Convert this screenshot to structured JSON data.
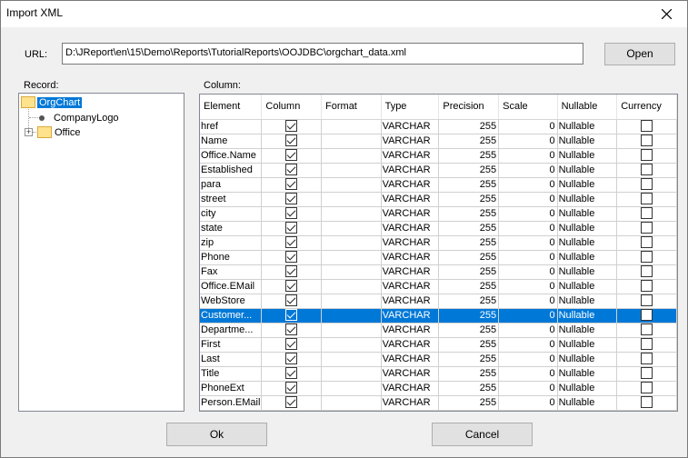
{
  "window": {
    "title": "Import XML"
  },
  "url": {
    "label": "URL:",
    "value": "D:\\JReport\\en\\15\\Demo\\Reports\\TutorialReports\\OOJDBC\\orgchart_data.xml"
  },
  "buttons": {
    "open": "Open",
    "ok": "Ok",
    "cancel": "Cancel"
  },
  "record": {
    "label": "Record:",
    "tree": [
      {
        "label": "OrgChart",
        "selected": true
      },
      {
        "label": "CompanyLogo"
      },
      {
        "label": "Office"
      }
    ]
  },
  "column": {
    "label": "Column:",
    "headers": [
      "Element",
      "Column",
      "Format",
      "Type",
      "Precision",
      "Scale",
      "Nullable",
      "Currency"
    ],
    "rows": [
      {
        "element": "href",
        "column": true,
        "format": "",
        "type": "VARCHAR",
        "precision": "255",
        "scale": "0",
        "nullable": "Nullable",
        "currency": false
      },
      {
        "element": "Name",
        "column": true,
        "format": "",
        "type": "VARCHAR",
        "precision": "255",
        "scale": "0",
        "nullable": "Nullable",
        "currency": false
      },
      {
        "element": "Office.Name",
        "column": true,
        "format": "",
        "type": "VARCHAR",
        "precision": "255",
        "scale": "0",
        "nullable": "Nullable",
        "currency": false
      },
      {
        "element": "Established",
        "column": true,
        "format": "",
        "type": "VARCHAR",
        "precision": "255",
        "scale": "0",
        "nullable": "Nullable",
        "currency": false
      },
      {
        "element": "para",
        "column": true,
        "format": "",
        "type": "VARCHAR",
        "precision": "255",
        "scale": "0",
        "nullable": "Nullable",
        "currency": false
      },
      {
        "element": "street",
        "column": true,
        "format": "",
        "type": "VARCHAR",
        "precision": "255",
        "scale": "0",
        "nullable": "Nullable",
        "currency": false
      },
      {
        "element": "city",
        "column": true,
        "format": "",
        "type": "VARCHAR",
        "precision": "255",
        "scale": "0",
        "nullable": "Nullable",
        "currency": false
      },
      {
        "element": "state",
        "column": true,
        "format": "",
        "type": "VARCHAR",
        "precision": "255",
        "scale": "0",
        "nullable": "Nullable",
        "currency": false
      },
      {
        "element": "zip",
        "column": true,
        "format": "",
        "type": "VARCHAR",
        "precision": "255",
        "scale": "0",
        "nullable": "Nullable",
        "currency": false
      },
      {
        "element": "Phone",
        "column": true,
        "format": "",
        "type": "VARCHAR",
        "precision": "255",
        "scale": "0",
        "nullable": "Nullable",
        "currency": false
      },
      {
        "element": "Fax",
        "column": true,
        "format": "",
        "type": "VARCHAR",
        "precision": "255",
        "scale": "0",
        "nullable": "Nullable",
        "currency": false
      },
      {
        "element": "Office.EMail",
        "column": true,
        "format": "",
        "type": "VARCHAR",
        "precision": "255",
        "scale": "0",
        "nullable": "Nullable",
        "currency": false
      },
      {
        "element": "WebStore",
        "column": true,
        "format": "",
        "type": "VARCHAR",
        "precision": "255",
        "scale": "0",
        "nullable": "Nullable",
        "currency": false
      },
      {
        "element": "Customer...",
        "column": true,
        "format": "",
        "type": "VARCHAR",
        "precision": "255",
        "scale": "0",
        "nullable": "Nullable",
        "currency": false,
        "selected": true
      },
      {
        "element": "Departme...",
        "column": true,
        "format": "",
        "type": "VARCHAR",
        "precision": "255",
        "scale": "0",
        "nullable": "Nullable",
        "currency": false
      },
      {
        "element": "First",
        "column": true,
        "format": "",
        "type": "VARCHAR",
        "precision": "255",
        "scale": "0",
        "nullable": "Nullable",
        "currency": false
      },
      {
        "element": "Last",
        "column": true,
        "format": "",
        "type": "VARCHAR",
        "precision": "255",
        "scale": "0",
        "nullable": "Nullable",
        "currency": false
      },
      {
        "element": "Title",
        "column": true,
        "format": "",
        "type": "VARCHAR",
        "precision": "255",
        "scale": "0",
        "nullable": "Nullable",
        "currency": false
      },
      {
        "element": "PhoneExt",
        "column": true,
        "format": "",
        "type": "VARCHAR",
        "precision": "255",
        "scale": "0",
        "nullable": "Nullable",
        "currency": false
      },
      {
        "element": "Person.EMail",
        "column": true,
        "format": "",
        "type": "VARCHAR",
        "precision": "255",
        "scale": "0",
        "nullable": "Nullable",
        "currency": false
      }
    ]
  },
  "colors": {
    "selection": "#0078d7"
  }
}
